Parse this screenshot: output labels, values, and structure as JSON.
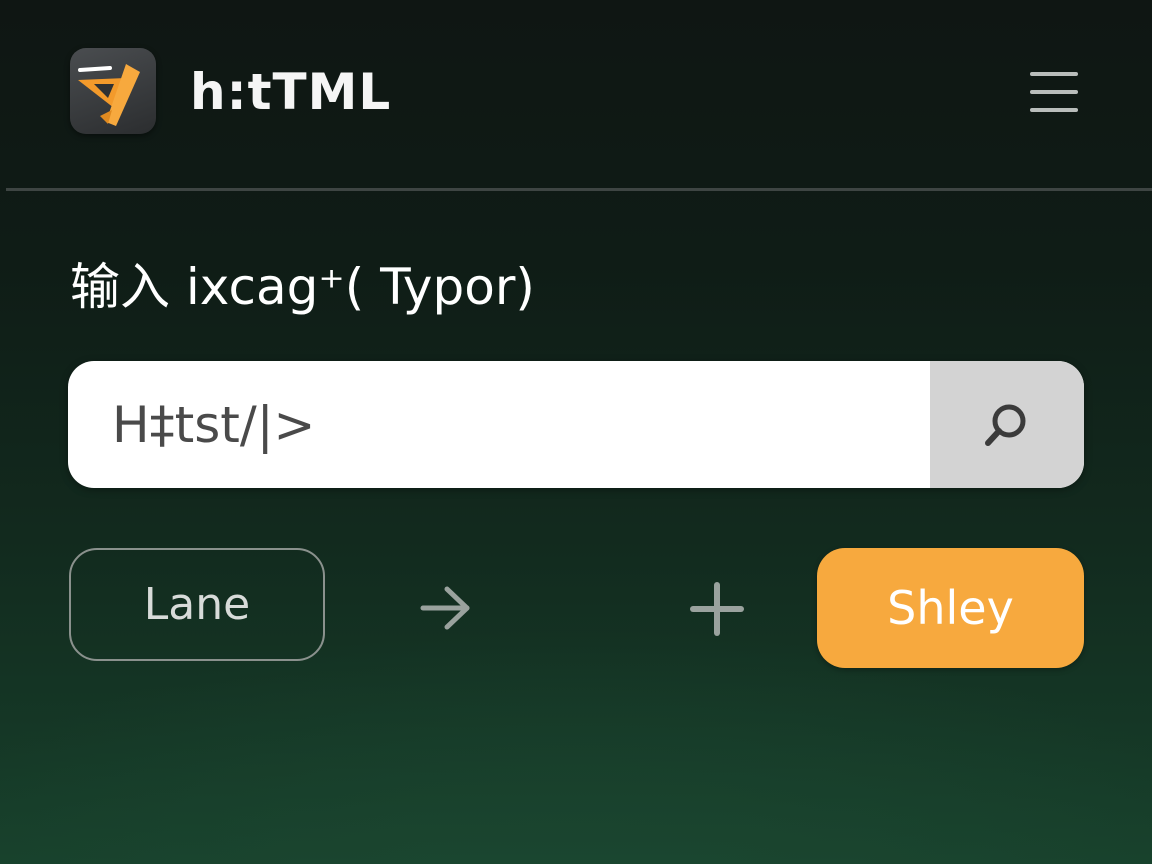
{
  "header": {
    "app_title": "h:tTML",
    "logo_icon": "app-logo-icon",
    "menu_icon": "hamburger-menu-icon"
  },
  "main": {
    "heading": "输入 ixcag⁺( Typor)",
    "search": {
      "value": "H‡tst/|>",
      "button_icon": "search-icon"
    },
    "actions": {
      "lane_label": "Lane",
      "arrow_icon": "arrow-right-icon",
      "plus_icon": "plus-icon",
      "shley_label": "Shley"
    }
  },
  "colors": {
    "accent": "#f7a93e",
    "search_button_bg": "#d3d3d3",
    "divider": "#3e4543",
    "background_top": "#0f1613",
    "background_bottom": "#17402b"
  }
}
